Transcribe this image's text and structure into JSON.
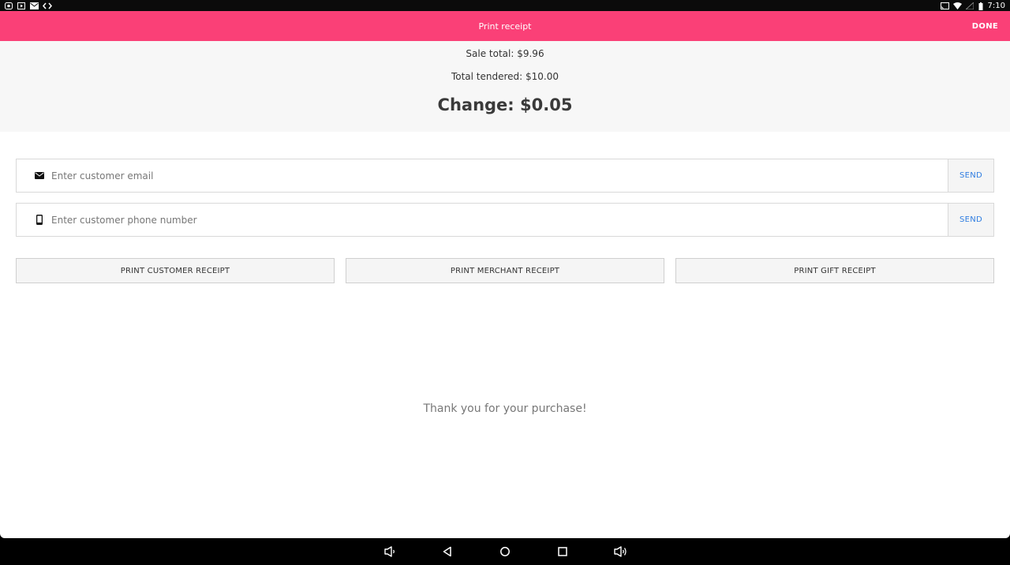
{
  "status_bar": {
    "time": "7:10",
    "left_icons": [
      "app-icon",
      "media-icon",
      "mail-icon",
      "code-icon"
    ],
    "right_icons": [
      "cast-icon",
      "wifi-icon",
      "signal-off-icon",
      "battery-icon"
    ]
  },
  "app_bar": {
    "title": "Print receipt",
    "done_label": "DONE",
    "color": "#fa4077"
  },
  "summary": {
    "sale_total": "Sale total: $9.96",
    "total_tendered": "Total tendered: $10.00",
    "change": "Change: $0.05"
  },
  "email": {
    "icon": "envelope-icon",
    "placeholder": "Enter customer email",
    "value": "",
    "send_label": "SEND"
  },
  "phone": {
    "icon": "phone-icon",
    "placeholder": "Enter customer phone number",
    "value": "",
    "send_label": "SEND"
  },
  "print_buttons": {
    "customer": "PRINT CUSTOMER RECEIPT",
    "merchant": "PRINT MERCHANT RECEIPT",
    "gift": "PRINT GIFT RECEIPT"
  },
  "message": "Thank you for your purchase!",
  "nav_bar": {
    "buttons": [
      "volume-down-icon",
      "back-icon",
      "home-icon",
      "recents-icon",
      "volume-up-icon"
    ]
  },
  "colors": {
    "accent": "#fa4077",
    "link": "#2f7de1"
  }
}
